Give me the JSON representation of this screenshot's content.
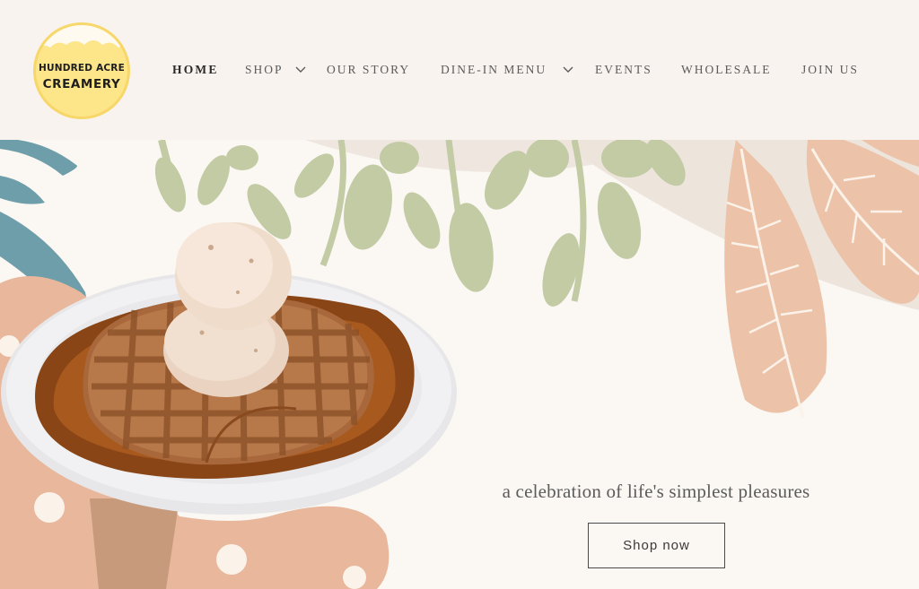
{
  "logo": {
    "line1": "HUNDRED ACRE",
    "line2": "CREAMERY"
  },
  "nav": {
    "items": [
      {
        "label": "HOME",
        "active": true
      },
      {
        "label": "SHOP",
        "dropdown": true
      },
      {
        "label": "OUR STORY"
      },
      {
        "label": "DINE-IN MENU",
        "dropdown": true
      },
      {
        "label": "EVENTS"
      },
      {
        "label": "WHOLESALE"
      },
      {
        "label": "JOIN US"
      }
    ]
  },
  "hero": {
    "tagline": "a celebration of life's simplest pleasures",
    "cta_label": "Shop now"
  },
  "colors": {
    "header_bg": "#f8f3ef",
    "hero_bg": "#fbf7f2",
    "logo_yellow": "#fde58a",
    "leaf_green": "#c2cba4",
    "leaf_peach": "#ecc3a8",
    "leaf_teal": "#6e9ea9"
  }
}
